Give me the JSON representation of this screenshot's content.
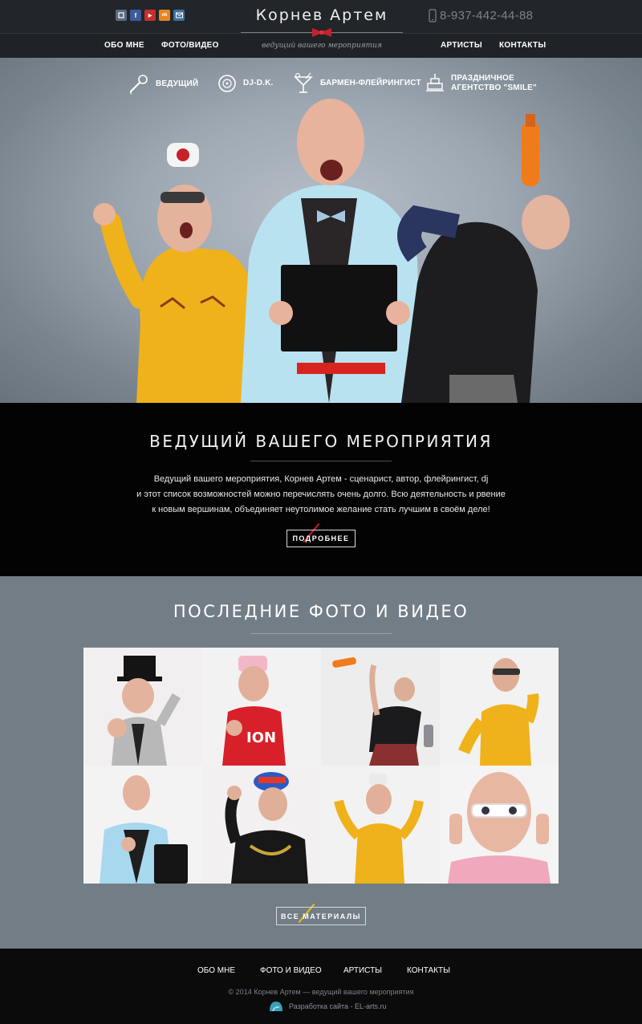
{
  "header": {
    "site_title": "Корнев Артем",
    "tagline": "ведущий вашего мероприятия",
    "phone": "8-937-442-44-88",
    "social": [
      {
        "name": "vk",
        "glyph": "",
        "color": "#5a6b80"
      },
      {
        "name": "facebook",
        "glyph": "f",
        "color": "#3b5b9a"
      },
      {
        "name": "youtube",
        "glyph": "▶",
        "color": "#c4302b"
      },
      {
        "name": "odnoklassniki",
        "glyph": "ok",
        "color": "#e98420"
      },
      {
        "name": "mail",
        "glyph": "",
        "color": "#3f6f9c"
      }
    ]
  },
  "nav": {
    "left": [
      "ОБО МНЕ",
      "ФОТО/ВИДЕО"
    ],
    "right": [
      "АРТИСТЫ",
      "КОНТАКТЫ"
    ]
  },
  "services": [
    {
      "label": "ВЕДУЩИЙ",
      "icon": "microphone-icon"
    },
    {
      "label": "DJ-D.K.",
      "icon": "vinyl-icon"
    },
    {
      "label": "БАРМЕН-ФЛЕЙРИНГИСТ",
      "icon": "cocktail-icon"
    },
    {
      "label_line1": "ПРАЗДНИЧНОЕ",
      "label_line2": "АГЕНТСТВО \"SMILE\"",
      "icon": "cake-icon"
    }
  ],
  "about": {
    "title": "ВЕДУЩИЙ ВАШЕГО МЕРОПРИЯТИЯ",
    "text_line1": "Ведущий вашего мероприятия, Корнев Артем - сценарист, автор, флейрингист, dj",
    "text_line2": "и этот список возможностей можно перечислять очень долго. Всю деятельность и рвение",
    "text_line3": "к новым вершинам, объединяет неутолимое желание стать лучшим в своём деле!",
    "button": "ПОДРОБНЕЕ"
  },
  "gallery": {
    "title": "ПОСЛЕДНИЕ ФОТО И ВИДЕО",
    "button": "ВСЕ МАТЕРИАЛЫ"
  },
  "footer": {
    "links": [
      "ОБО МНЕ",
      "ФОТО И ВИДЕО",
      "АРТИСТЫ",
      "КОНТАКТЫ"
    ],
    "copyright": "© 2014 Корнев Артем — ведущий вашего мероприятия",
    "developer": "Разработка сайта - EL-arts.ru"
  },
  "colors": {
    "accent_red": "#c8212c",
    "accent_yellow": "#e6c21a",
    "topbar": "#22262b",
    "gallery_bg": "#737d86"
  }
}
